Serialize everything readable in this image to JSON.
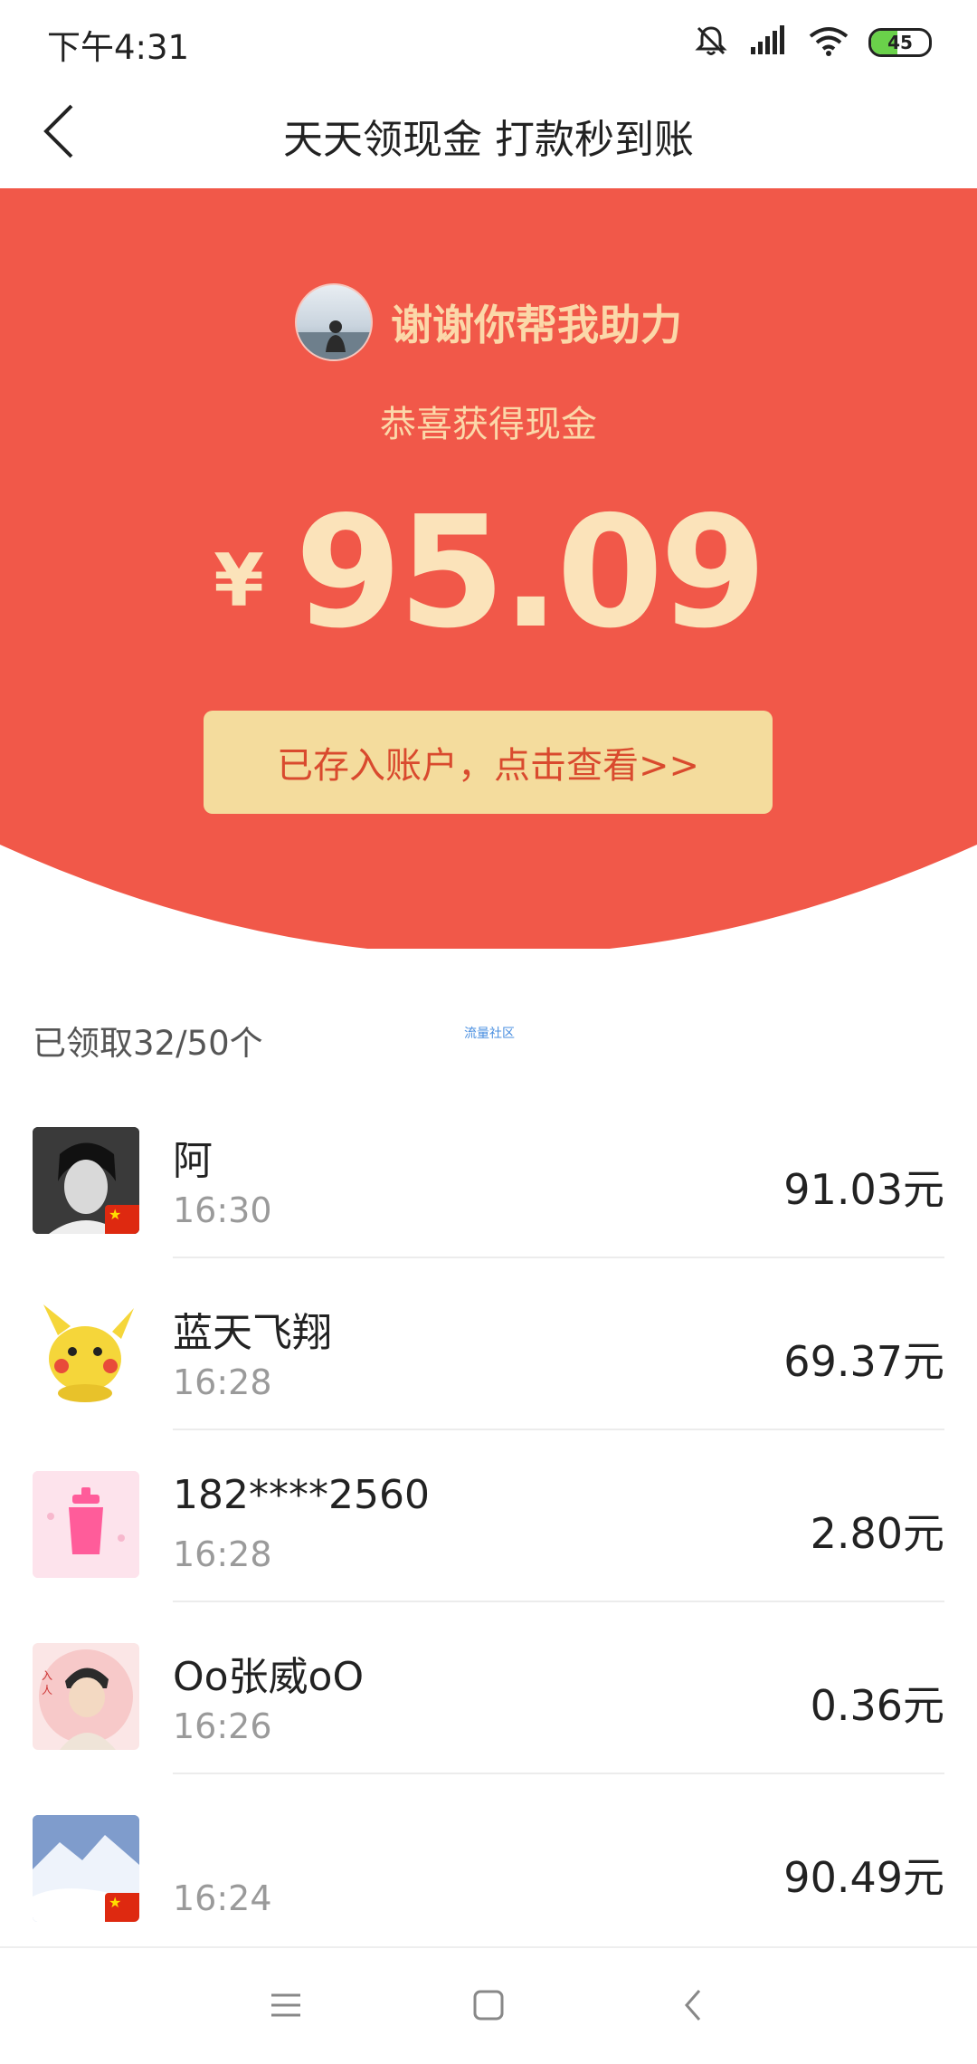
{
  "status_bar": {
    "time": "下午4:31",
    "battery_level": "45"
  },
  "nav": {
    "title": "天天领现金 打款秒到账"
  },
  "hero": {
    "helper_text": "谢谢你帮我助力",
    "congrats": "恭喜获得现金",
    "currency": "¥",
    "amount": "95.09",
    "view_account_label": "已存入账户，点击查看>>"
  },
  "claimed": {
    "count_label": "已领取32/50个",
    "watermark": "流量社区"
  },
  "records": [
    {
      "name": "阿",
      "time": "16:30",
      "amount": "91.03元"
    },
    {
      "name": "蓝天飞翔",
      "time": "16:28",
      "amount": "69.37元"
    },
    {
      "name": "182****2560",
      "time": "16:28",
      "amount": "2.80元"
    },
    {
      "name": "Oo张威oO",
      "time": "16:26",
      "amount": "0.36元"
    },
    {
      "name": "",
      "time": "16:24",
      "amount": "90.49元"
    }
  ],
  "icons": {
    "back": "chevron-left-icon",
    "menu": "menu-icon",
    "home": "home-square-icon",
    "nav_back": "nav-back-icon"
  },
  "colors": {
    "hero_red": "#f15849",
    "gold_text": "#fbe3ba",
    "button_bg": "#f4dc9d",
    "button_text": "#d94a2e"
  }
}
